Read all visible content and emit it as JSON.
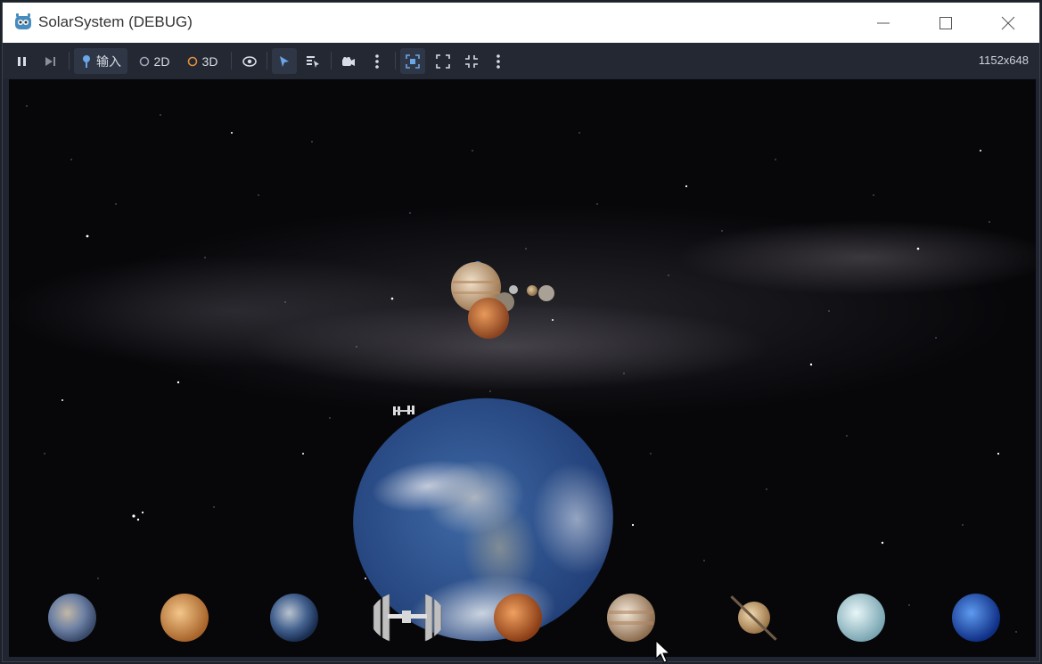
{
  "window": {
    "title": "SolarSystem (DEBUG)",
    "controls": {
      "minimize": "—",
      "maximize": "☐",
      "close": "✕"
    }
  },
  "toolbar": {
    "input_label": "输入",
    "mode_2d_label": "2D",
    "mode_3d_label": "3D",
    "resolution": "1152x648"
  },
  "viewport": {
    "scene": "Solar system render",
    "planet_thumbnails": [
      "mercury-icon",
      "venus-icon",
      "earth-icon",
      "iss-icon",
      "mars-icon",
      "jupiter-icon",
      "saturn-icon",
      "uranus-icon",
      "neptune-icon"
    ]
  },
  "colors": {
    "toolbar_bg": "#232833",
    "accent": "#4a90e2",
    "mode_3d": "#e0913a"
  }
}
